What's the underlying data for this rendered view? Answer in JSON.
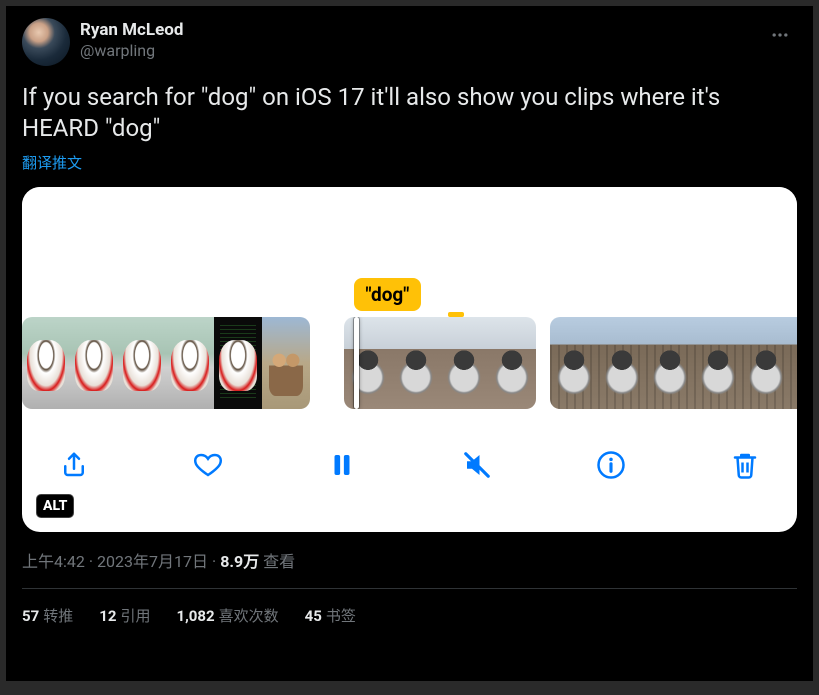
{
  "author": {
    "display_name": "Ryan McLeod",
    "handle": "@warpling"
  },
  "tweet_text": "If you search for \"dog\" on iOS 17 it'll also show you clips where it's HEARD \"dog\"",
  "translate_label": "翻译推文",
  "media": {
    "highlight_tag": "\"dog\"",
    "alt_badge": "ALT"
  },
  "meta": {
    "time": "上午4:42",
    "date": "2023年7月17日",
    "views_count": "8.9万",
    "views_label": "查看"
  },
  "stats": {
    "retweets": {
      "count": "57",
      "label": "转推"
    },
    "quotes": {
      "count": "12",
      "label": "引用"
    },
    "likes": {
      "count": "1,082",
      "label": "喜欢次数"
    },
    "bookmarks": {
      "count": "45",
      "label": "书签"
    }
  }
}
